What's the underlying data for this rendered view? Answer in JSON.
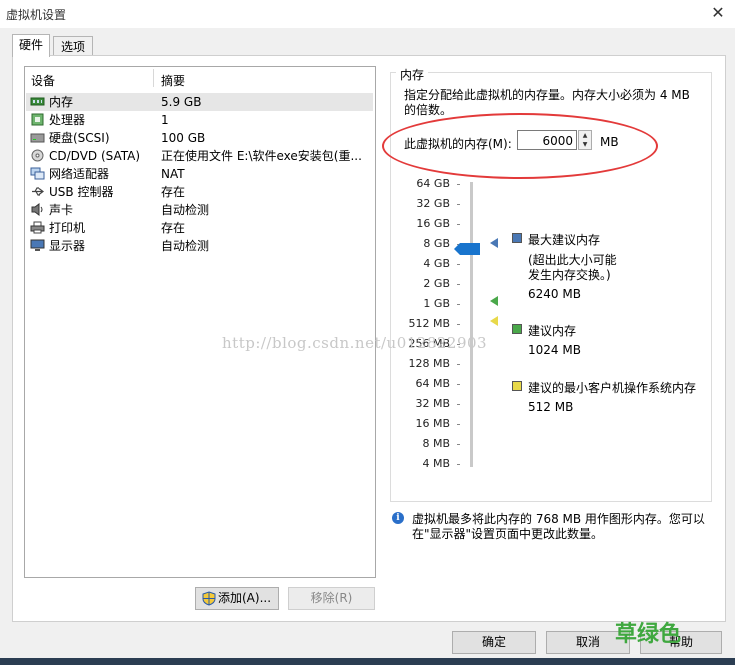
{
  "window": {
    "title": "虚拟机设置",
    "close": "✕"
  },
  "tabs": [
    {
      "label": "硬件"
    },
    {
      "label": "选项"
    }
  ],
  "device_list": {
    "headers": {
      "device": "设备",
      "summary": "摘要"
    },
    "rows": [
      {
        "name": "内存",
        "summary": "5.9 GB",
        "icon": "memory-icon"
      },
      {
        "name": "处理器",
        "summary": "1",
        "icon": "processor-icon"
      },
      {
        "name": "硬盘(SCSI)",
        "summary": "100 GB",
        "icon": "hard-disk-icon"
      },
      {
        "name": "CD/DVD (SATA)",
        "summary": "正在使用文件 E:\\软件exe安装包(重...",
        "icon": "cd-dvd-icon"
      },
      {
        "name": "网络适配器",
        "summary": "NAT",
        "icon": "network-adapter-icon"
      },
      {
        "name": "USB 控制器",
        "summary": "存在",
        "icon": "usb-icon"
      },
      {
        "name": "声卡",
        "summary": "自动检测",
        "icon": "sound-card-icon"
      },
      {
        "name": "打印机",
        "summary": "存在",
        "icon": "printer-icon"
      },
      {
        "name": "显示器",
        "summary": "自动检测",
        "icon": "display-icon"
      }
    ],
    "add_button": "添加(A)...",
    "remove_button": "移除(R)"
  },
  "memory": {
    "group_title": "内存",
    "description": "指定分配给此虚拟机的内存量。内存大小必须为 4 MB 的倍数。",
    "field_label": "此虚拟机的内存(M):",
    "value": "6000",
    "unit": "MB",
    "scale_labels": [
      "64 GB",
      "32 GB",
      "16 GB",
      "8 GB",
      "4 GB",
      "2 GB",
      "1 GB",
      "512 MB",
      "256 MB",
      "128 MB",
      "64 MB",
      "32 MB",
      "16 MB",
      "8 MB",
      "4 MB"
    ],
    "legend": {
      "max_title": "最大建议内存",
      "max_note_1": "(超出此大小可能",
      "max_note_2": "发生内存交换。)",
      "max_value": "6240 MB",
      "rec_title": "建议内存",
      "rec_value": "1024 MB",
      "min_title": "建议的最小客户机操作系统内存",
      "min_value": "512 MB"
    },
    "colors": {
      "max": "#4a78b5",
      "recommended": "#4aa84a",
      "minimum": "#e8d94a",
      "slider": "#1874cd"
    }
  },
  "info": {
    "text_1": "虚拟机最多将此内存的 768 MB 用作图形内存。您可以",
    "text_2": "在\"显示器\"设置页面中更改此数量。"
  },
  "buttons": {
    "ok": "确定",
    "cancel": "取消",
    "help": "帮助"
  },
  "overlay": {
    "watermark": "http://blog.csdn.net/u012822903",
    "corner_mark": "草绿色"
  }
}
